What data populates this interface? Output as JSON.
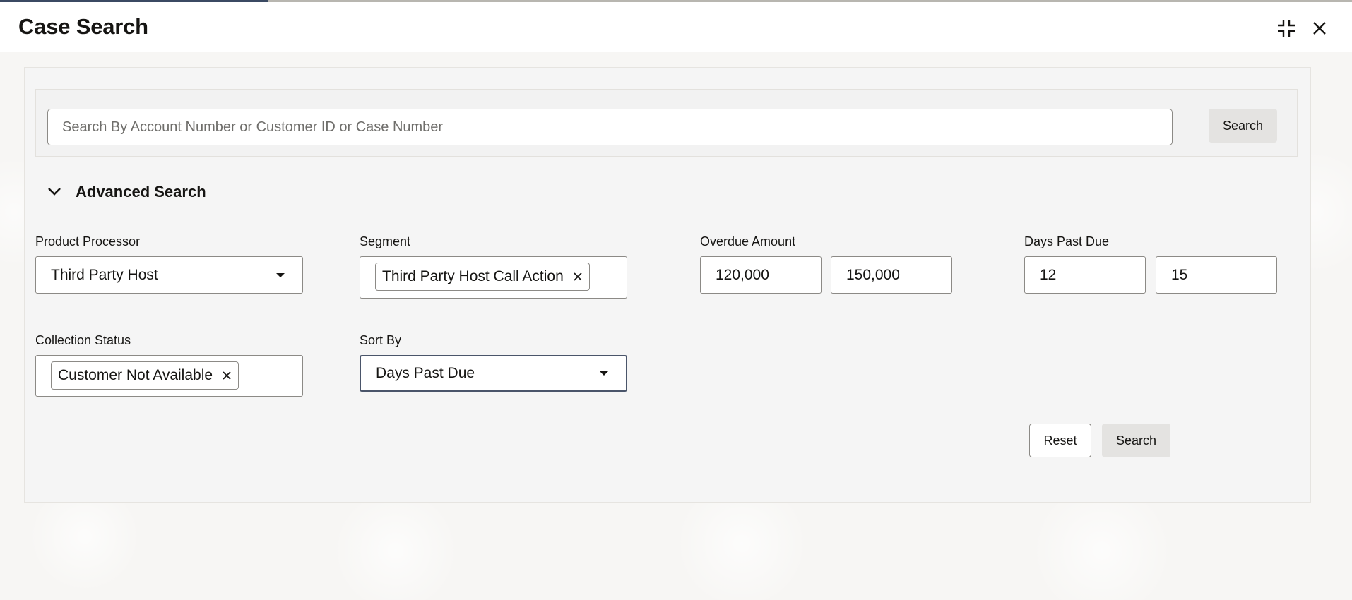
{
  "header": {
    "title": "Case Search",
    "collapse_icon": "collapse-icon",
    "close_icon": "close-icon"
  },
  "quick_search": {
    "placeholder": "Search By Account Number or Customer ID or Case Number",
    "value": "",
    "button_label": "Search"
  },
  "advanced": {
    "toggle_label": "Advanced Search",
    "toggle_icon": "chevron-down-icon",
    "expanded": true
  },
  "fields": {
    "product_processor": {
      "label": "Product Processor",
      "value": "Third Party Host"
    },
    "segment": {
      "label": "Segment",
      "chips": [
        "Third Party Host Call Action"
      ]
    },
    "overdue_amount": {
      "label": "Overdue Amount",
      "from": "120,000",
      "to": "150,000"
    },
    "days_past_due": {
      "label": "Days Past Due",
      "from": "12",
      "to": "15"
    },
    "collection_status": {
      "label": "Collection Status",
      "chips": [
        "Customer Not Available"
      ]
    },
    "sort_by": {
      "label": "Sort By",
      "value": "Days Past Due"
    }
  },
  "actions": {
    "reset_label": "Reset",
    "search_label": "Search"
  },
  "colors": {
    "card_background": "#f5f5f5",
    "button_grey": "#e4e3e1",
    "border": "#8c8a86",
    "focus_border": "#4a556a"
  }
}
